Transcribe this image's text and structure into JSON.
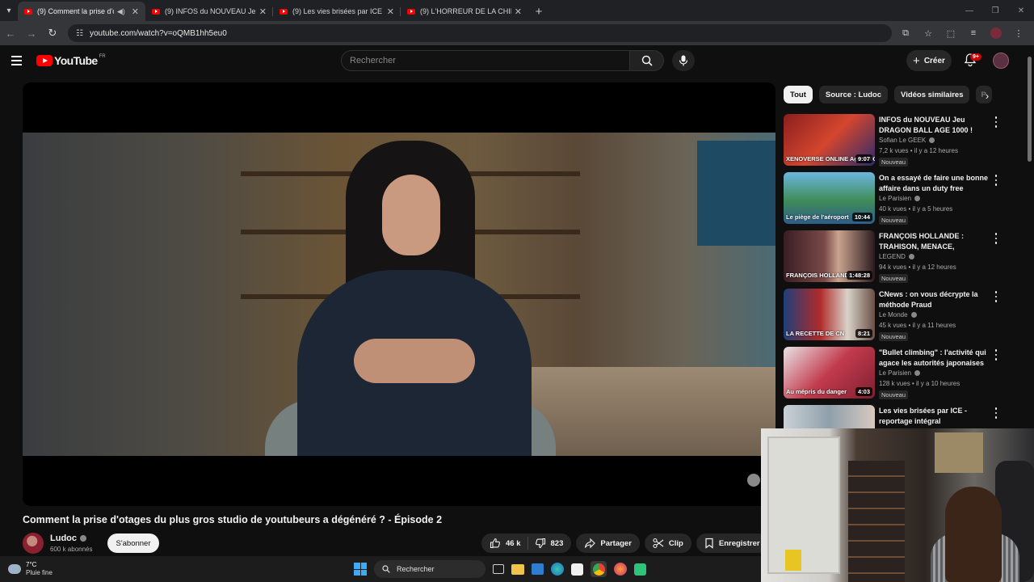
{
  "browser": {
    "tabs": [
      {
        "title": "(9) Comment la prise d'otag",
        "active": true,
        "audio": true
      },
      {
        "title": "(9) INFOS du NOUVEAU Jeu DR",
        "active": false,
        "audio": false
      },
      {
        "title": "(9) Les vies brisées par ICE - rep",
        "active": false,
        "audio": false
      },
      {
        "title": "(9) L'HORREUR DE LA CHIRURG",
        "active": false,
        "audio": false
      }
    ],
    "url": "youtube.com/watch?v=oQMB1hh5eu0"
  },
  "youtube": {
    "logo_text": "YouTube",
    "country": "FR",
    "search_placeholder": "Rechercher",
    "create_label": "Créer",
    "notif_count": "9+"
  },
  "video": {
    "title": "Comment la prise d'otages du plus gros studio de youtubeurs a dégénéré ? - Épisode 2",
    "channel": "Ludoc",
    "subscribers": "600 k abonnés",
    "subscribe_label": "S'abonner",
    "likes": "46 k",
    "dislikes": "823",
    "share_label": "Partager",
    "clip_label": "Clip",
    "save_label": "Enregistrer"
  },
  "chips": [
    "Tout",
    "Source : Ludoc",
    "Vidéos similaires",
    "P"
  ],
  "related": [
    {
      "title": "INFOS du NOUVEAU Jeu DRAGON BALL AGE 1000 !",
      "channel": "Sofian Le GEEK",
      "meta": "7,2 k vues • il y a 12 heures",
      "badge": "Nouveau",
      "duration": "9:07",
      "thumb_text": "XENOVERSE ONLINE Age 1000",
      "thumb_color": "#c0392b"
    },
    {
      "title": "On a essayé de faire une bonne affaire dans un duty free",
      "channel": "Le Parisien",
      "meta": "40 k vues • il y a 5 heures",
      "badge": "Nouveau",
      "duration": "10:44",
      "thumb_text": "Le piège de l'aéroport",
      "thumb_color": "#3a7fa8"
    },
    {
      "title": "FRANÇOIS HOLLANDE : TRAHISON, MENACE, MACRO…",
      "channel": "LEGEND",
      "meta": "94 k vues • il y a 12 heures",
      "badge": "Nouveau",
      "duration": "1:48:28",
      "thumb_text": "FRANÇOIS HOLLANDE",
      "thumb_color": "#5b2c36"
    },
    {
      "title": "CNews : on vous décrypte la méthode Praud",
      "channel": "Le Monde",
      "meta": "45 k vues • il y a 11 heures",
      "badge": "Nouveau",
      "duration": "8:21",
      "thumb_text": "LA RECETTE DE CN",
      "thumb_color": "#1f3f7a"
    },
    {
      "title": "\"Bullet climbing\" : l'activité qui agace les autorités japonaises",
      "channel": "Le Parisien",
      "meta": "128 k vues • il y a 10 heures",
      "badge": "Nouveau",
      "duration": "4:03",
      "thumb_text": "Au mépris du danger",
      "thumb_color": "#b8344a"
    },
    {
      "title": "Les vies brisées par ICE - reportage intégral",
      "channel": "",
      "meta": "",
      "badge": "",
      "duration": "",
      "thumb_text": "",
      "thumb_color": "#9aa7b0"
    }
  ],
  "taskbar": {
    "temp": "7°C",
    "weather": "Pluie fine",
    "search_label": "Rechercher"
  },
  "colors": {
    "youtube_red": "#ff0000",
    "background": "#0f0f0f",
    "chip_bg": "#272727"
  }
}
